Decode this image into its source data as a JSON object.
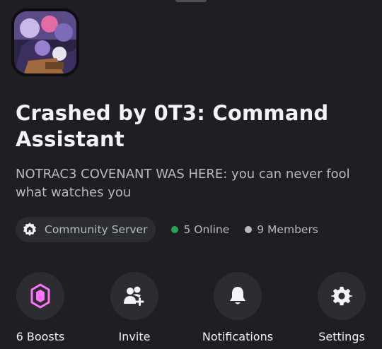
{
  "server": {
    "name": "Crashed by 0T3: Command Assistant",
    "description": "NOTRAC3 COVENANT WAS HERE: you can never fool what watches you"
  },
  "meta": {
    "community_label": "Community Server",
    "online": "5 Online",
    "members": "9 Members",
    "online_color": "#23a55a",
    "members_color": "#b5bac1"
  },
  "actions": [
    {
      "label": "6 Boosts",
      "icon": "boost-gem-icon"
    },
    {
      "label": "Invite",
      "icon": "add-user-icon"
    },
    {
      "label": "Notifications",
      "icon": "bell-icon"
    },
    {
      "label": "Settings",
      "icon": "gear-icon"
    }
  ],
  "colors": {
    "background": "#1f1f23",
    "surface": "#2b2d31",
    "boost": "#ff73fa"
  }
}
